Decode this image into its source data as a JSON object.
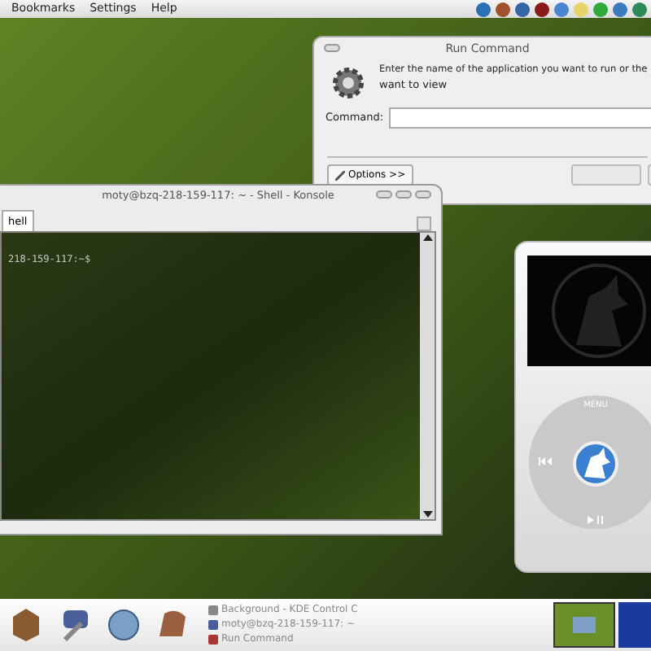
{
  "menubar": {
    "items": [
      "Bookmarks",
      "Settings",
      "Help"
    ]
  },
  "run_dialog": {
    "title": "Run Command",
    "message": "Enter the name of the application you want to run or the",
    "message_line_2": "want to view",
    "command_label": "Command:",
    "options_button": "Options >>"
  },
  "konsole": {
    "title": "moty@bzq-218-159-117: ~ - Shell - Konsole",
    "tab": "hell",
    "prompt": "218-159-117:~$"
  },
  "media_player": {
    "menu_label": "MENU"
  },
  "taskbar": {
    "tasks": [
      {
        "label": "Background - KDE Control C"
      },
      {
        "label": "moty@bzq-218-159-117: ~"
      },
      {
        "label": "Run Command"
      }
    ]
  }
}
